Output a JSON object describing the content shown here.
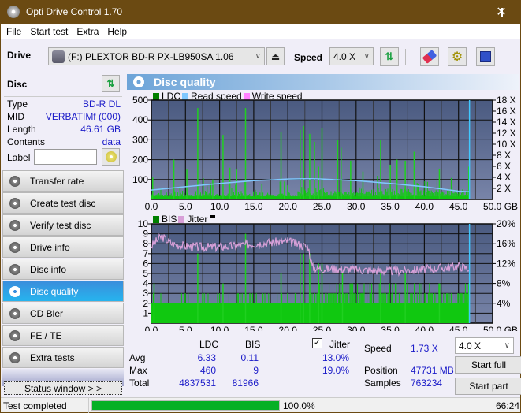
{
  "window": {
    "title": "Opti Drive Control 1.70",
    "minimize": "—",
    "maximize": "☐",
    "close": "✕"
  },
  "menu": [
    "File",
    "Start test",
    "Extra",
    "Help"
  ],
  "toolbar": {
    "drive_label": "Drive",
    "drive_value": "(F:)  PLEXTOR BD-R  PX-LB950SA 1.06",
    "speed_label": "Speed",
    "speed_value": "4.0 X"
  },
  "disc": {
    "header": "Disc",
    "rows": [
      {
        "label": "Type",
        "value": "BD-R DL"
      },
      {
        "label": "MID",
        "value": "VERBATIMf (000)"
      },
      {
        "label": "Length",
        "value": "46.61 GB"
      },
      {
        "label": "Contents",
        "value": "data"
      }
    ],
    "label_field": {
      "label": "Label",
      "value": ""
    }
  },
  "nav": [
    "Transfer rate",
    "Create test disc",
    "Verify test disc",
    "Drive info",
    "Disc info",
    "Disc quality",
    "CD Bler",
    "FE / TE",
    "Extra tests"
  ],
  "nav_active": "Disc quality",
  "status_window_btn": "Status window > >",
  "panel": {
    "title": "Disc quality"
  },
  "chart_data": [
    {
      "type": "bar",
      "title": "LDC",
      "legend": [
        "LDC",
        "Read speed",
        "Write speed"
      ],
      "legend_colors": [
        "#008000",
        "#80c8ff",
        "#ff80ff"
      ],
      "xlabel": "GB",
      "x_ticks": [
        "0.0",
        "5.0",
        "10.0",
        "15.0",
        "20.0",
        "25.0",
        "30.0",
        "35.0",
        "40.0",
        "45.0",
        "50.0 GB"
      ],
      "xlim": [
        0,
        50
      ],
      "y_ticks_left": [
        "100",
        "200",
        "300",
        "400",
        "500"
      ],
      "ylim_left": [
        0,
        500
      ],
      "y_ticks_right": [
        "2 X",
        "4 X",
        "6 X",
        "8 X",
        "10 X",
        "12 X",
        "14 X",
        "16 X",
        "18 X"
      ],
      "ylim_right": [
        0,
        18
      ],
      "ldc_peaks": [
        [
          0.2,
          110
        ],
        [
          3.3,
          200
        ],
        [
          4.2,
          60
        ],
        [
          5.2,
          150
        ],
        [
          6.8,
          460
        ],
        [
          9.0,
          100
        ],
        [
          10.5,
          325
        ],
        [
          11.5,
          160
        ],
        [
          12.5,
          150
        ],
        [
          13.8,
          460
        ],
        [
          16.2,
          80
        ],
        [
          19.0,
          340
        ],
        [
          19.5,
          90
        ],
        [
          21.8,
          350
        ],
        [
          22.3,
          370
        ],
        [
          23.2,
          330
        ],
        [
          23.9,
          290
        ],
        [
          24.5,
          165
        ],
        [
          25.0,
          360
        ],
        [
          27.3,
          300
        ],
        [
          27.8,
          260
        ],
        [
          29.2,
          195
        ],
        [
          31.0,
          140
        ],
        [
          33.6,
          300
        ],
        [
          35.0,
          175
        ],
        [
          36.0,
          200
        ],
        [
          37.2,
          195
        ],
        [
          38.5,
          240
        ],
        [
          42.2,
          155
        ],
        [
          46.5,
          165
        ]
      ],
      "ldc_baseline": 15,
      "read_speed": [
        [
          0,
          1.7
        ],
        [
          5,
          2.3
        ],
        [
          10,
          2.9
        ],
        [
          15,
          3.4
        ],
        [
          20,
          3.7
        ],
        [
          23.5,
          3.75
        ],
        [
          25,
          3.7
        ],
        [
          30,
          3.4
        ],
        [
          35,
          2.9
        ],
        [
          40,
          2.3
        ],
        [
          45,
          1.5
        ],
        [
          46.61,
          1.4
        ]
      ],
      "end_marker_gb": 46.61
    },
    {
      "type": "bar",
      "title": "BIS / Jitter",
      "legend": [
        "BIS",
        "Jitter"
      ],
      "legend_colors": [
        "#008000",
        "#d8a0d8"
      ],
      "xlabel": "GB",
      "x_ticks": [
        "0.0",
        "5.0",
        "10.0",
        "15.0",
        "20.0",
        "25.0",
        "30.0",
        "35.0",
        "40.0",
        "45.0",
        "50.0 GB"
      ],
      "xlim": [
        0,
        50
      ],
      "y_ticks_left": [
        "1",
        "2",
        "3",
        "4",
        "5",
        "6",
        "7",
        "8",
        "9",
        "10"
      ],
      "ylim_left": [
        0,
        10
      ],
      "y_ticks_right": [
        "4%",
        "8%",
        "12%",
        "16%",
        "20%"
      ],
      "ylim_right": [
        0,
        20
      ],
      "bis_peaks": [
        [
          0.4,
          4
        ],
        [
          6.8,
          7
        ],
        [
          10.5,
          4
        ],
        [
          13.8,
          9
        ],
        [
          19.0,
          5
        ],
        [
          21.8,
          7
        ],
        [
          22.3,
          7
        ],
        [
          23.2,
          7
        ],
        [
          24.5,
          6
        ],
        [
          25.0,
          6
        ],
        [
          28.0,
          5
        ],
        [
          33.6,
          5
        ],
        [
          37.2,
          5
        ],
        [
          42.2,
          4
        ],
        [
          46.5,
          4
        ]
      ],
      "bis_baseline": 2,
      "jitter": [
        [
          0,
          15.5
        ],
        [
          1.5,
          17.5
        ],
        [
          3,
          16
        ],
        [
          5,
          15.5
        ],
        [
          8,
          15.3
        ],
        [
          12,
          15.5
        ],
        [
          15,
          16
        ],
        [
          20,
          16.5
        ],
        [
          23,
          15.3
        ],
        [
          23.6,
          11.2
        ],
        [
          25,
          11
        ],
        [
          30,
          10.8
        ],
        [
          35,
          10.5
        ],
        [
          40,
          10.8
        ],
        [
          45,
          11.5
        ],
        [
          46.61,
          11
        ]
      ],
      "end_marker_gb": 46.61
    }
  ],
  "stats": {
    "col_ldc": "LDC",
    "col_bis": "BIS",
    "jitter_label": "Jitter",
    "jitter_checked": true,
    "rows": [
      {
        "label": "Avg",
        "ldc": "6.33",
        "bis": "0.11",
        "jitter": "13.0%"
      },
      {
        "label": "Max",
        "ldc": "460",
        "bis": "9",
        "jitter": "19.0%"
      },
      {
        "label": "Total",
        "ldc": "4837531",
        "bis": "81966",
        "jitter": ""
      }
    ],
    "speed_label": "Speed",
    "speed_value": "1.73 X",
    "position_label": "Position",
    "position_value": "47731 MB",
    "samples_label": "Samples",
    "samples_value": "763234",
    "speed_select": "4.0 X",
    "start_full": "Start full",
    "start_part": "Start part"
  },
  "statusbar": {
    "text": "Test completed",
    "progress": 100,
    "progress_text": "100.0%",
    "time": "66:24"
  }
}
